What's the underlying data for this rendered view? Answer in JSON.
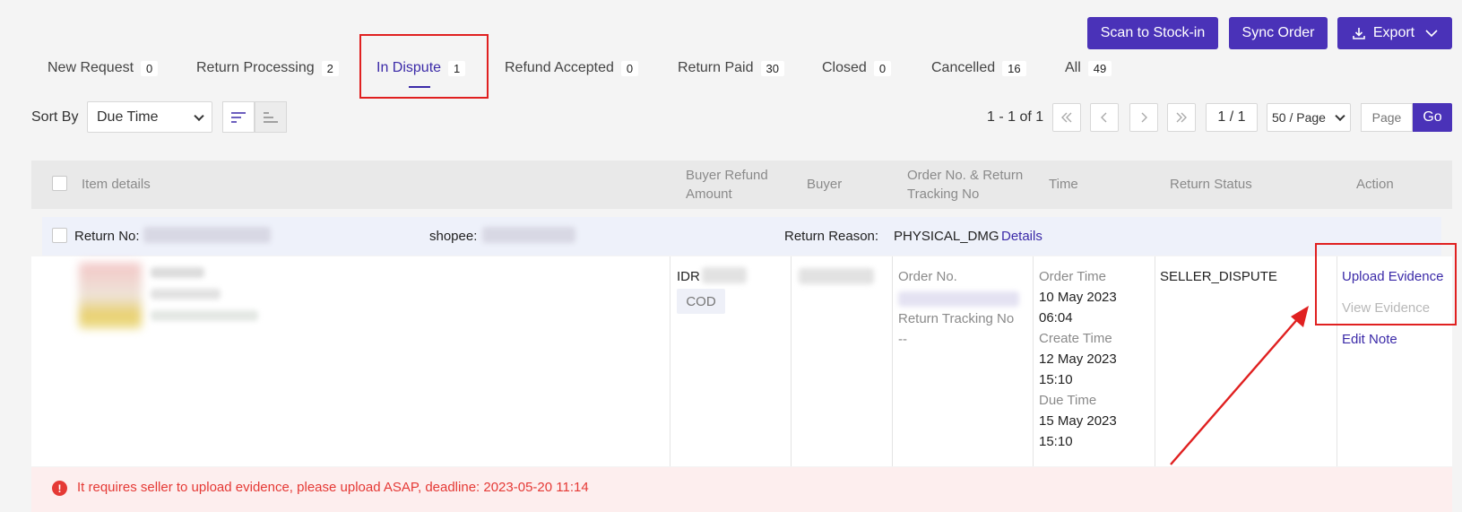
{
  "toolbar": {
    "scan_label": "Scan to Stock-in",
    "sync_label": "Sync Order",
    "export_label": "Export"
  },
  "tabs": [
    {
      "label": "New Request",
      "count": "0"
    },
    {
      "label": "Return Processing",
      "count": "2"
    },
    {
      "label": "In Dispute",
      "count": "1",
      "active": true
    },
    {
      "label": "Refund Accepted",
      "count": "0"
    },
    {
      "label": "Return Paid",
      "count": "30"
    },
    {
      "label": "Closed",
      "count": "0"
    },
    {
      "label": "Cancelled",
      "count": "16"
    },
    {
      "label": "All",
      "count": "49"
    }
  ],
  "sort": {
    "label": "Sort By",
    "selected": "Due Time"
  },
  "pagination": {
    "range": "1 - 1 of 1",
    "page_display": "1 / 1",
    "page_size": "50 / Page",
    "page_input_placeholder": "Page",
    "go_label": "Go"
  },
  "table": {
    "headers": {
      "item_details": "Item details",
      "refund_amount": "Buyer Refund Amount",
      "buyer": "Buyer",
      "order_no": "Order No. & Return Tracking No",
      "time": "Time",
      "return_status": "Return Status",
      "action": "Action"
    },
    "return_row": {
      "return_no_label": "Return No:",
      "shop_label": "shopee:",
      "reason_label": "Return Reason:",
      "reason_value": "PHYSICAL_DMG",
      "details_link": "Details"
    },
    "row": {
      "currency": "IDR",
      "payment": "COD",
      "order_no_label": "Order No.",
      "tracking_label": "Return Tracking No",
      "tracking_value": "--",
      "order_time_label": "Order Time",
      "order_time_date": "10 May 2023",
      "order_time_clock": "06:04",
      "create_time_label": "Create Time",
      "create_time_date": "12 May 2023",
      "create_time_clock": "15:10",
      "due_time_label": "Due Time",
      "due_time_date": "15 May 2023",
      "due_time_clock": "15:10",
      "status": "SELLER_DISPUTE",
      "actions": {
        "upload": "Upload Evidence",
        "view": "View Evidence",
        "edit": "Edit Note"
      }
    }
  },
  "alert": {
    "icon": "!",
    "text": "It requires seller to upload evidence, please upload ASAP, deadline: 2023-05-20 11:14"
  },
  "colors": {
    "accent": "#4a32b8",
    "annotation": "#e02020",
    "alert": "#e53935"
  }
}
